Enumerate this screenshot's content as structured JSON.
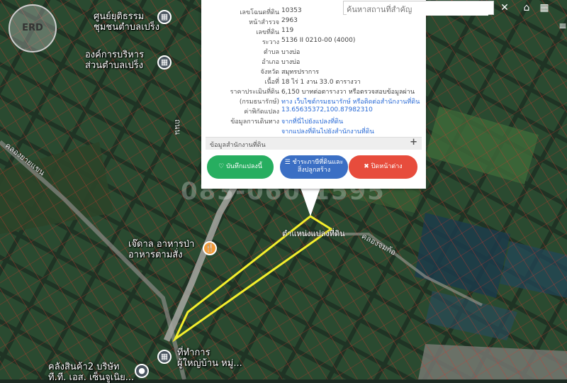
{
  "search": {
    "placeholder": "ค้นหาสถานที่สำคัญ"
  },
  "toolbar": {
    "clear_icon": "close-icon",
    "home_icon": "home-icon",
    "grid_icon": "grid-icon",
    "menu_icon": "hamburger-icon"
  },
  "logo": {
    "text": "ERD"
  },
  "watermark": {
    "text": "083-060-1595"
  },
  "popup": {
    "rows": [
      {
        "label": "เลขโฉนดที่ดิน",
        "value": "10353"
      },
      {
        "label": "หน้าสำรวจ",
        "value": "2963"
      },
      {
        "label": "เลขที่ดิน",
        "value": "119"
      },
      {
        "label": "ระวาง",
        "value": "5136 II 0210-00 (4000)"
      },
      {
        "label": "ตำบล",
        "value": "บางบ่อ"
      },
      {
        "label": "อำเภอ",
        "value": "บางบ่อ"
      },
      {
        "label": "จังหวัด",
        "value": "สมุทรปราการ"
      },
      {
        "label": "เนื้อที่",
        "value": "18 ไร่ 1 งาน 33.0 ตารางวา"
      },
      {
        "label": "ราคาประเมินที่ดิน",
        "value": "6,150 บาทต่อตารางวา หรือตรวจสอบข้อมูลผ่าน"
      },
      {
        "label": "(กรมธนารักษ์)",
        "value": "ทาง เว็บไซต์กรมธนารักษ์ หรือติดต่อสำนักงานที่ดิน"
      },
      {
        "label": "ค่าพิกัดแปลง",
        "value": "13.65635372,100.87982310"
      },
      {
        "label": "ข้อมูลการเดินทาง",
        "value": "จากที่นี่ไปยังแปลงที่ดิน"
      },
      {
        "label": "",
        "value": "จากแปลงที่ดินไปยังสำนักงานที่ดิน"
      }
    ],
    "office_label": "ข้อมูลสำนักงานที่ดิน",
    "office_toggle": "+",
    "buttons": {
      "save": "บันทึกแปลงนี้",
      "tax_line1": "ชำระภาษีที่ดินและ",
      "tax_line2": "สิ่งปลูกสร้าง",
      "close": "ปิดหน้าต่าง"
    }
  },
  "map": {
    "parcel_label": "ตำแหน่งแปลงที่ดิน",
    "pois": [
      {
        "name": "ศูนย์ยุติธรรม",
        "line2": "ชุมชนตำบลเปร็ง",
        "icon": "building-icon"
      },
      {
        "name": "องค์การบริหาร",
        "line2": "ส่วนตำบลเปร็ง",
        "icon": "building-icon"
      },
      {
        "name": "เจ๊ดาล อาหารป่า",
        "line2": "อาหารตามสั่ง",
        "icon": "food-icon"
      },
      {
        "name": "ที่ทำการ",
        "line2": "ผู้ใหญ่บ้าน หมู่...",
        "icon": "building-icon"
      },
      {
        "name": "คลังสินค้า2 บริษัท",
        "line2": "ที.ที. เอส. เซ็นจูเนิย...",
        "icon": "location-icon"
      }
    ],
    "road_labels": [
      "คลองยายแขน",
      "คลองจมก้อ",
      "ถนน"
    ],
    "colors": {
      "parcel": "#f4ee2c",
      "boundary": "#d9342b",
      "popup_link": "#2a6bd6"
    }
  }
}
